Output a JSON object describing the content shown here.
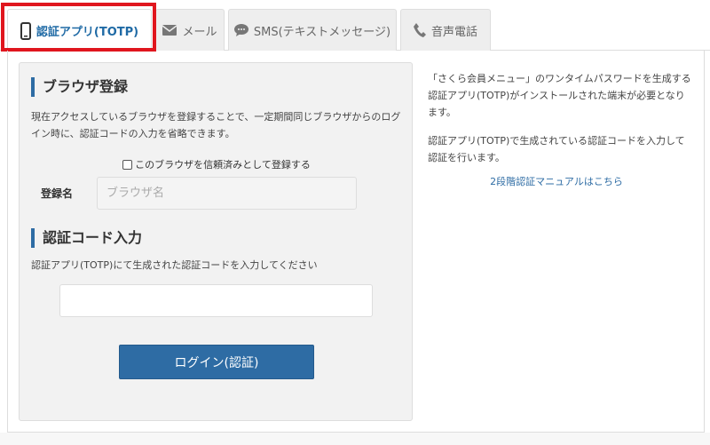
{
  "tabs": [
    {
      "label": "認証アプリ(TOTP)",
      "icon": "smartphone-icon",
      "active": true
    },
    {
      "label": "メール",
      "icon": "envelope-icon",
      "active": false
    },
    {
      "label": "SMS(テキストメッセージ)",
      "icon": "chat-bubble-icon",
      "active": false
    },
    {
      "label": "音声電話",
      "icon": "phone-icon",
      "active": false
    }
  ],
  "highlight_color": "#e0161e",
  "accent_color": "#2e6ca4",
  "browser_section": {
    "title": "ブラウザ登録",
    "description": "現在アクセスしているブラウザを登録することで、一定期間同じブラウザからのログイン時に、認証コードの入力を省略できます。",
    "checkbox_label": "このブラウザを信頼済みとして登録する",
    "name_label": "登録名",
    "name_placeholder": "ブラウザ名"
  },
  "code_section": {
    "title": "認証コード入力",
    "description": "認証アプリ(TOTP)にて生成された認証コードを入力してください",
    "code_value": "",
    "login_label": "ログイン(認証)"
  },
  "info": {
    "paragraph1": "「さくら会員メニュー」のワンタイムパスワードを生成する認証アプリ(TOTP)がインストールされた端末が必要となります。",
    "paragraph2": "認証アプリ(TOTP)で生成されている認証コードを入力して認証を行います。",
    "manual_link": "2段階認証マニュアルはこちら"
  }
}
